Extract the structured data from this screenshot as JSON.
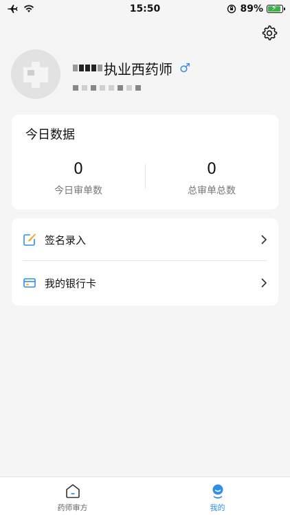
{
  "status_bar": {
    "time": "15:50",
    "battery": "89%",
    "battery_level": 0.89
  },
  "profile": {
    "name_suffix": "执业西药师",
    "gender_symbol": "♂"
  },
  "today": {
    "title": "今日数据",
    "today_count": "0",
    "today_label": "今日审单数",
    "total_count": "0",
    "total_label": "总审单总数"
  },
  "menu": {
    "items": [
      {
        "label": "签名录入",
        "icon": "sign-edit-icon"
      },
      {
        "label": "我的银行卡",
        "icon": "bank-card-icon"
      }
    ]
  },
  "tabs": [
    {
      "label": "药师审方",
      "icon": "home-icon",
      "active": false
    },
    {
      "label": "我的",
      "icon": "profile-icon",
      "active": true
    }
  ],
  "colors": {
    "accent": "#2f8ee6",
    "background": "#f5f5f5",
    "battery": "#3bb14a"
  }
}
